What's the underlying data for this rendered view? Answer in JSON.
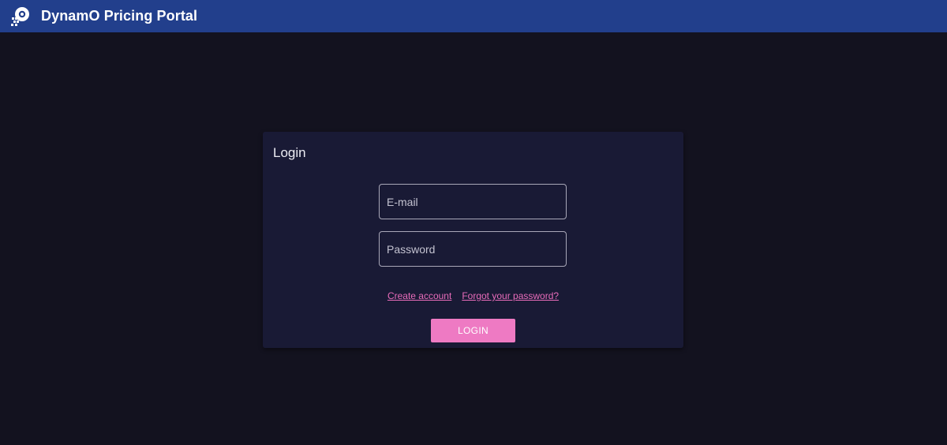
{
  "header": {
    "logo_icon": "rocket-logo-icon",
    "title": "DynamO Pricing Portal",
    "background": "#223f8c"
  },
  "login": {
    "title": "Login",
    "email": {
      "placeholder": "E-mail",
      "value": ""
    },
    "password": {
      "placeholder": "Password",
      "value": ""
    },
    "links": {
      "create_account": "Create account",
      "forgot_password": "Forgot your password?"
    },
    "button_label": "LOGIN"
  },
  "colors": {
    "page_background": "#13121f",
    "card_background": "#191a35",
    "accent": "#ee7ac3",
    "link": "#e86cba"
  }
}
